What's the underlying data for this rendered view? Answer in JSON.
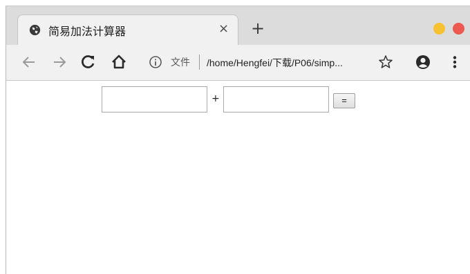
{
  "tab": {
    "title": "简易加法计算器",
    "close_label": "×",
    "favicon": "globe-icon"
  },
  "newtab_label": "+",
  "window_controls": {
    "minimize_color": "#f7c232",
    "close_color": "#ec5a4f"
  },
  "toolbar": {
    "back_icon": "back-arrow-icon",
    "forward_icon": "forward-arrow-icon",
    "reload_icon": "reload-icon",
    "home_icon": "home-icon",
    "info_icon": "info-icon",
    "file_label": "文件",
    "url": "/home/Hengfei/下载/P06/simp...",
    "bookmark_icon": "star-icon",
    "profile_icon": "account-icon",
    "menu_icon": "more-vertical-icon"
  },
  "calculator": {
    "operand1_value": "",
    "operator": "+",
    "operand2_value": "",
    "equals_label": "="
  }
}
